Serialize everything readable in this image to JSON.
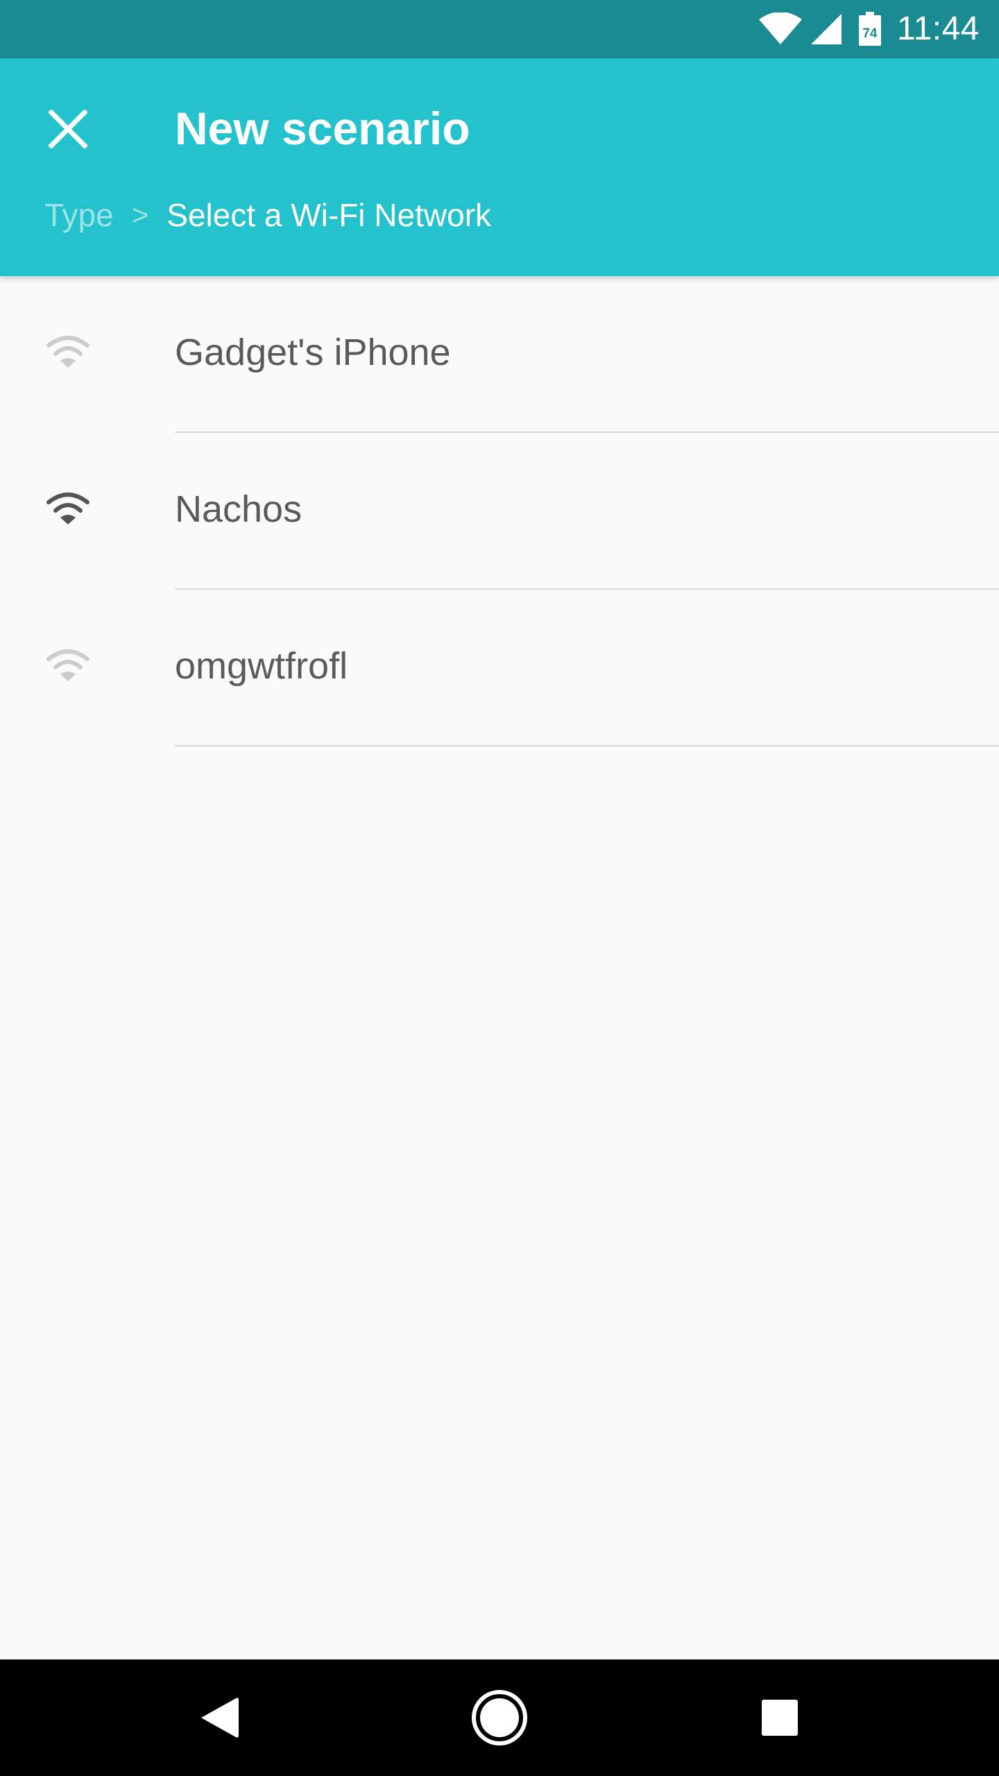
{
  "status_bar": {
    "time": "11:44",
    "battery_level": "74",
    "icons": [
      "wifi-icon",
      "cell-signal-icon",
      "battery-icon"
    ]
  },
  "app_bar": {
    "title": "New scenario",
    "close_icon": "close-icon",
    "breadcrumb": {
      "type_label": "Type",
      "separator": ">",
      "current_label": "Select a Wi-Fi Network"
    },
    "color": "#24c2cc"
  },
  "networks": [
    {
      "name": "Gadget's iPhone",
      "icon": "wifi-icon",
      "connected": false
    },
    {
      "name": "Nachos",
      "icon": "wifi-icon",
      "connected": true
    },
    {
      "name": "omgwtfrofl",
      "icon": "wifi-icon",
      "connected": false
    }
  ],
  "nav_bar": {
    "icons": [
      "back-icon",
      "home-icon",
      "recents-icon"
    ]
  },
  "colors": {
    "status_bar": "#1a8a93",
    "accent": "#24c2cc",
    "wifi_inactive": "#cccccc",
    "wifi_active": "#555555"
  }
}
